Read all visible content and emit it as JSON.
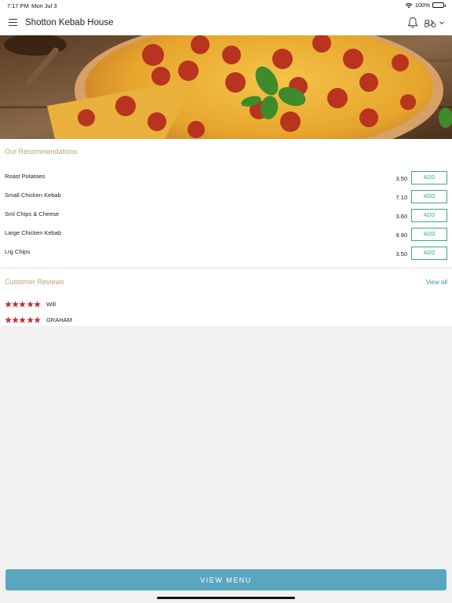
{
  "status_bar": {
    "time": "7:17 PM",
    "date": "Mon Jul 3",
    "battery": "100%"
  },
  "header": {
    "title": "Shotton Kebab House",
    "icons": [
      "menu-icon",
      "bell-icon",
      "scooter-icon",
      "chevron-down-icon"
    ]
  },
  "hero": {
    "image": "pepperoni-pizza-photo"
  },
  "recommendations": {
    "title": "Our Recommendations",
    "items": [
      {
        "name": "Roast Potatoes",
        "price": "3.50",
        "button": "ADD"
      },
      {
        "name": "Small Chicken Kebab",
        "price": "7.10",
        "button": "ADD"
      },
      {
        "name": "Sml Chips & Cheese",
        "price": "3.60",
        "button": "ADD"
      },
      {
        "name": "Large Chicken Kebab",
        "price": "9.90",
        "button": "ADD"
      },
      {
        "name": "Lrg Chips",
        "price": "3.50",
        "button": "ADD"
      }
    ]
  },
  "reviews": {
    "title": "Customer Reviews",
    "view_all": "View all",
    "items": [
      {
        "rating": 5,
        "name": "Will"
      },
      {
        "rating": 5,
        "name": "GRAHAM"
      }
    ]
  },
  "footer": {
    "button": "VIEW MENU"
  },
  "colors": {
    "accent": "#5aa6bf",
    "add_green": "#3fa77a",
    "section_title": "#b8a37a",
    "star": "#d1262f",
    "link": "#3a8fb5"
  }
}
